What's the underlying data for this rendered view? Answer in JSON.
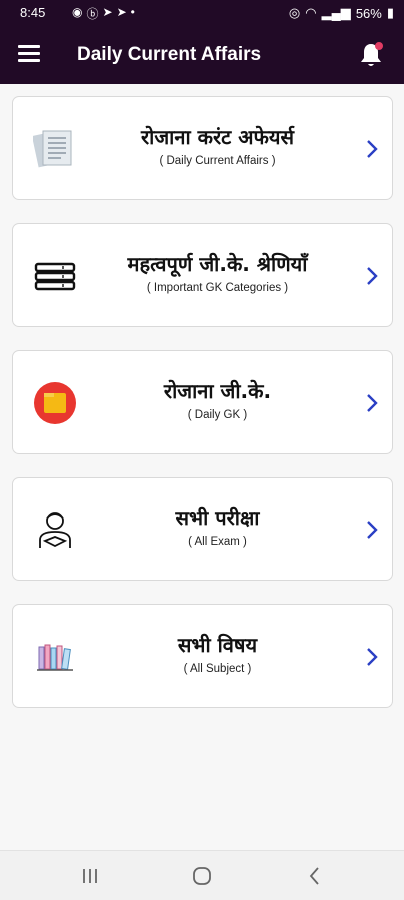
{
  "status": {
    "time": "8:45",
    "battery": "56%"
  },
  "header": {
    "title": "Daily Current Affairs"
  },
  "cards": [
    {
      "title": "रोजाना करंट अफेयर्स",
      "subtitle": "( Daily Current Affairs )",
      "icon": "document-icon"
    },
    {
      "title": "महत्वपूर्ण जी.के. श्रेणियाँ",
      "subtitle": "( Important GK Categories )",
      "icon": "books-stack-icon"
    },
    {
      "title": "रोजाना जी.के.",
      "subtitle": "( Daily GK )",
      "icon": "quiz-icon"
    },
    {
      "title": "सभी परीक्षा",
      "subtitle": "( All Exam )",
      "icon": "student-icon"
    },
    {
      "title": "सभी विषय",
      "subtitle": "( All Subject )",
      "icon": "bookshelf-icon"
    }
  ],
  "colors": {
    "appbar": "#210a26",
    "chevron": "#2a3fc4",
    "notification_dot": "#e23b63"
  }
}
